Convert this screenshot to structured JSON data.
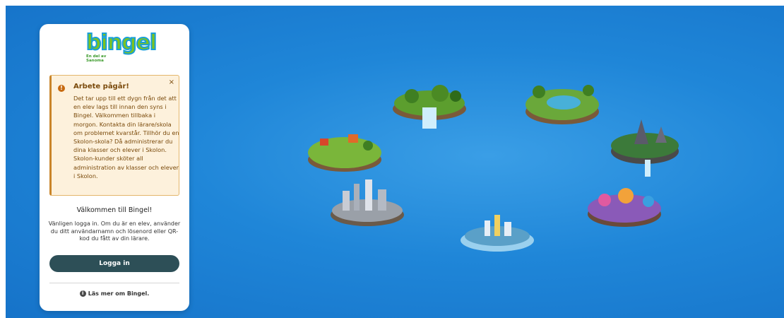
{
  "brand": {
    "logo": "bingel",
    "tagline": "En del av Sanoma"
  },
  "alert": {
    "title": "Arbete pågår!",
    "close": "×",
    "body": "Det tar upp till ett dygn från det att en elev lags till innan den syns i Bingel. Välkommen tillbaka i morgon. Kontakta din lärare/skola om problemet kvarstår. Tillhör du en Skolon-skola? Då administrerar du dina klasser och elever i Skolon. Skolon-kunder sköter all administration av klasser och elever i Skolon."
  },
  "login": {
    "welcome": "Välkommen till Bingel!",
    "intro": "Vänligen logga in. Om du är en elev, använder du ditt användarnamn och lösenord eller QR-kod du fått av din lärare.",
    "button": "Logga in",
    "more": "Läs mer om Bingel."
  },
  "icons": {
    "alert": "exclamation-icon",
    "info": "info-icon",
    "close": "close-icon"
  },
  "colors": {
    "background": "#1f86d8",
    "button": "#2d4f57",
    "alert_bg": "#fdf1dc",
    "alert_border": "#c9852a",
    "logo_green": "#7dc41e",
    "logo_blue": "#1a9fd8"
  }
}
